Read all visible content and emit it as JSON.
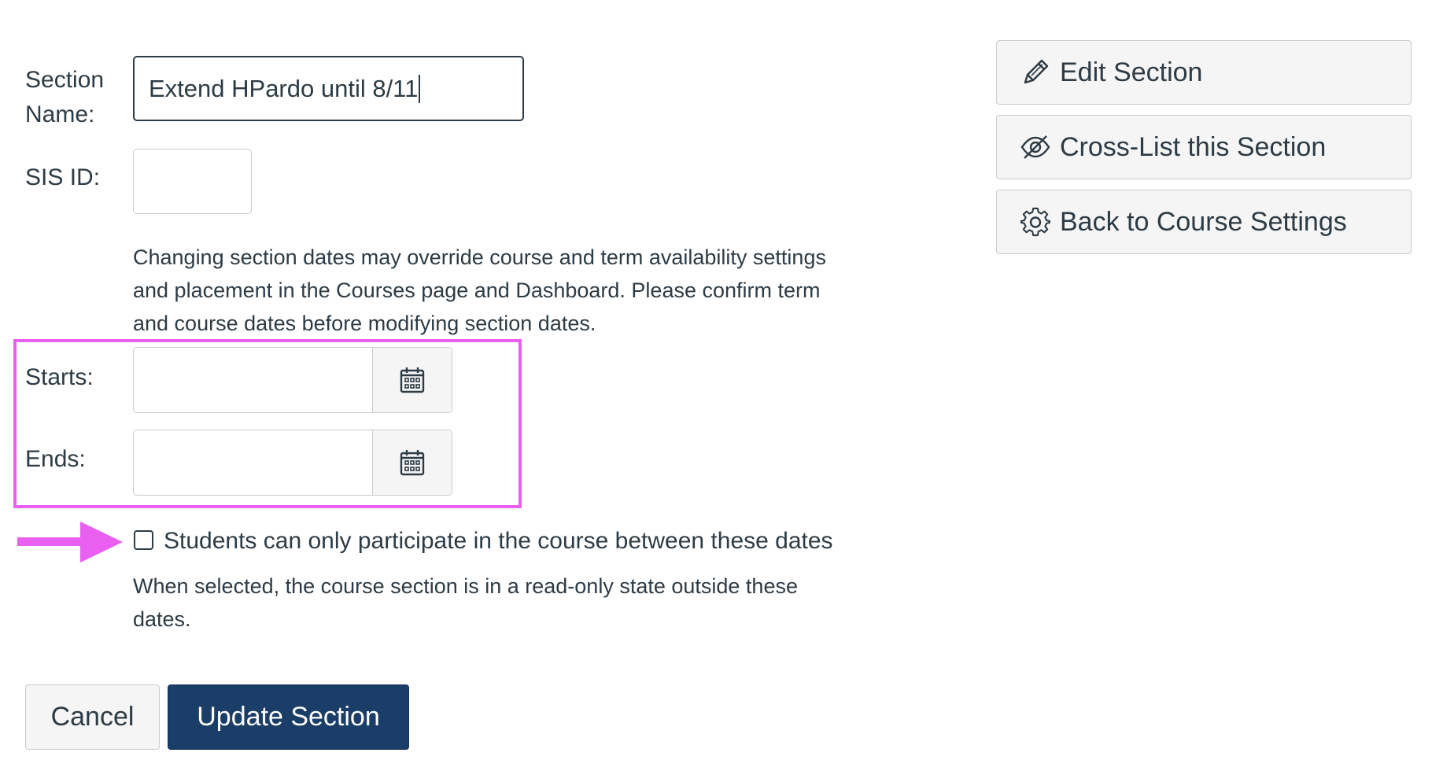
{
  "form": {
    "section_name_label_line1": "Section",
    "section_name_label_line2": "Name:",
    "section_name_value": "Extend HPardo until 8/11",
    "sis_id_label": "SIS ID:",
    "sis_id_value": "",
    "dates_notice_line1": "Changing section dates may override course and term availability settings",
    "dates_notice_line2": "and placement in the Courses page and Dashboard. Please confirm term",
    "dates_notice_line3": "and course dates before modifying section dates.",
    "starts_label": "Starts:",
    "starts_value": "",
    "ends_label": "Ends:",
    "ends_value": "",
    "restrict_checkbox_checked": false,
    "restrict_checkbox_label": "Students can only participate in the course between these dates",
    "restrict_help_line1": "When selected, the course section is in a read-only state outside these",
    "restrict_help_line2": "dates.",
    "cancel_label": "Cancel",
    "update_label": "Update Section"
  },
  "sidebar": {
    "buttons": [
      {
        "label": "Edit Section",
        "icon": "pencil-icon"
      },
      {
        "label": "Cross-List this Section",
        "icon": "eye-slash-icon"
      },
      {
        "label": "Back to Course Settings",
        "icon": "gear-icon"
      }
    ]
  },
  "annotations": {
    "highlight_color": "#e95ff0",
    "arrow_color": "#e95ff0"
  },
  "colors": {
    "primary_button": "#1b3e68",
    "text": "#2d3b45",
    "border": "#c7cdd1"
  }
}
